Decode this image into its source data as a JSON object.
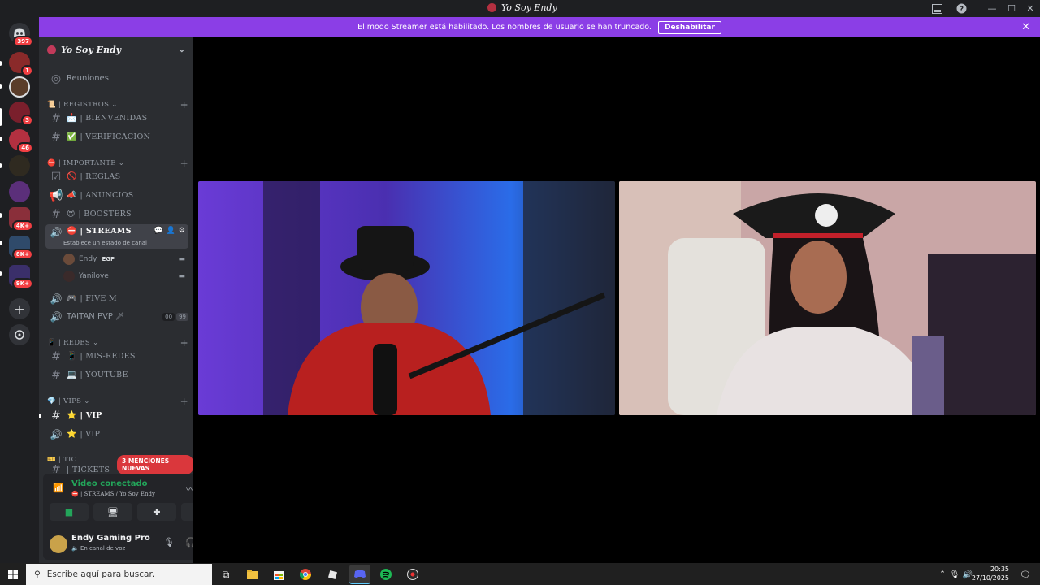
{
  "window": {
    "title": "Yo Soy Endy"
  },
  "streamer_mode": {
    "message": "El modo Streamer está habilitado. Los nombres de usuario se han truncado.",
    "button": "Deshabilitar"
  },
  "servers": {
    "home_badge": "397",
    "items": [
      {
        "badge": "1",
        "color": "#8a2a2a"
      },
      {
        "badge": "",
        "color": "#5a3d2a"
      },
      {
        "badge": "3",
        "color": "#7a1f2c"
      },
      {
        "badge": "46",
        "color": "#b33040"
      },
      {
        "badge": "",
        "color": "#2f2a20"
      },
      {
        "badge": "",
        "color": "#5b2f7a"
      },
      {
        "badge": "4K+",
        "color": "#8a2f3a"
      },
      {
        "badge": "8K+",
        "color": "#2f4a6a"
      },
      {
        "badge": "9K+",
        "color": "#3a2f6a"
      }
    ]
  },
  "sidebar": {
    "server_name": "Yo Soy Endy",
    "reuniones": "Reuniones",
    "categories": {
      "registros": "| REGISTROS",
      "importante": "| IMPORTANTE",
      "redes": "| REDES",
      "vips": "| VIPS",
      "tickets": "| TIC"
    },
    "channels": {
      "bienvenidas": "| BIENVENIDAS",
      "verificacion": "| VERIFICACION",
      "reglas": "| REGLAS",
      "anuncios": "| ANUNCIOS",
      "boosters": "| BOOSTERS",
      "streams": "| STREAMS",
      "streams_status": "Establece un estado de canal",
      "five_m": "| FIVE M",
      "taitan": "TAITAN PVP",
      "taitan_count_a": "00",
      "taitan_count_b": "99",
      "mis_redes": "| MIS-REDES",
      "youtube": "| YOUTUBE",
      "vip_text": "| VIP",
      "vip_voice": "| VIP",
      "tickets_partial": "| TICKETS"
    },
    "members": [
      {
        "name": "Endy",
        "tag": "EGP"
      },
      {
        "name": "Yanilove",
        "tag": ""
      }
    ],
    "mentions_badge": "3 MENCIONES NUEVAS"
  },
  "voice_panel": {
    "status": "Video conectado",
    "channel": "| STREAMS / Yo Soy Endy"
  },
  "user_panel": {
    "name": "Endy Gaming Pro",
    "status": "En canal de voz"
  },
  "taskbar": {
    "search_placeholder": "Escribe aquí para buscar.",
    "time": "20:35",
    "date": "27/10/2025"
  },
  "colors": {
    "streamer_bar": "#8b3ee6",
    "connected_green": "#23a55a",
    "badge_red": "#f23f43"
  }
}
